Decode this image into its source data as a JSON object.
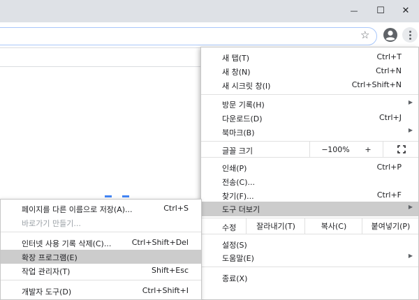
{
  "window": {
    "minimize_glyph": "—",
    "maximize_glyph": "☐",
    "close_glyph": "✕"
  },
  "toolbar": {
    "star_icon": "☆"
  },
  "menu": {
    "new_tab": {
      "label": "새 탭(T)",
      "shortcut": "Ctrl+T"
    },
    "new_window": {
      "label": "새 창(N)",
      "shortcut": "Ctrl+N"
    },
    "new_incognito": {
      "label": "새 시크릿 창(I)",
      "shortcut": "Ctrl+Shift+N"
    },
    "history": {
      "label": "방문 기록(H)"
    },
    "downloads": {
      "label": "다운로드(D)",
      "shortcut": "Ctrl+J"
    },
    "bookmarks": {
      "label": "북마크(B)"
    },
    "zoom": {
      "label": "글꼴 크기",
      "minus": "−",
      "value": "100%",
      "plus": "+"
    },
    "print": {
      "label": "인쇄(P)",
      "shortcut": "Ctrl+P"
    },
    "cast": {
      "label": "전송(C)..."
    },
    "find": {
      "label": "찾기(F)...",
      "shortcut": "Ctrl+F"
    },
    "more_tools": {
      "label": "도구 더보기"
    },
    "edit": {
      "label": "수정",
      "cut": "잘라내기(T)",
      "copy": "복사(C)",
      "paste": "붙여넣기(P)"
    },
    "settings": {
      "label": "설정(S)"
    },
    "help": {
      "label": "도움말(E)"
    },
    "exit": {
      "label": "종료(X)"
    }
  },
  "submenu": {
    "save_page": {
      "label": "페이지를 다른 이름으로 저장(A)...",
      "shortcut": "Ctrl+S"
    },
    "create_shortcut": {
      "label": "바로가기 만들기..."
    },
    "clear_data": {
      "label": "인터넷 사용 기록 삭제(C)...",
      "shortcut": "Ctrl+Shift+Del"
    },
    "extensions": {
      "label": "확장 프로그램(E)"
    },
    "task_manager": {
      "label": "작업 관리자(T)",
      "shortcut": "Shift+Esc"
    },
    "dev_tools": {
      "label": "개발자 도구(D)",
      "shortcut": "Ctrl+Shift+I"
    }
  },
  "colors": {
    "highlight": "#cccccc",
    "titlebar": "#dee1e6",
    "omnibox_border": "#a8c7fa"
  }
}
